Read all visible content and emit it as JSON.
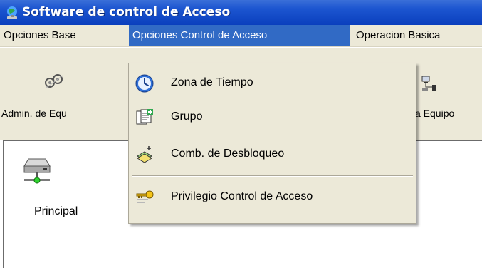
{
  "window": {
    "title": "Software de control de Acceso"
  },
  "menubar": {
    "items": [
      {
        "label": "Opciones Base"
      },
      {
        "label": "Opciones Control de Acceso",
        "active": true
      },
      {
        "label": "Operacion Basica"
      }
    ]
  },
  "toolbar": {
    "buttons": [
      {
        "label": "Admin. de Equ",
        "icon": "network-admin-icon"
      },
      {
        "label": "a Equipo",
        "icon": "computer-network-icon"
      }
    ]
  },
  "tree": {
    "nodes": [
      {
        "label": "Principal",
        "icon": "network-drive-icon"
      }
    ]
  },
  "dropdown": {
    "items": [
      {
        "label": "Zona de Tiempo",
        "icon": "clock-icon"
      },
      {
        "label": "Grupo",
        "icon": "group-doc-icon"
      },
      {
        "label": "Comb. de Desbloqueo",
        "icon": "unlock-combination-icon"
      },
      {
        "label": "Privilegio Control de Acceso",
        "icon": "keys-icon"
      }
    ]
  },
  "colors": {
    "titlebar": "#0a3fbd",
    "menu_highlight": "#316ac5",
    "chrome": "#ece9d8"
  }
}
